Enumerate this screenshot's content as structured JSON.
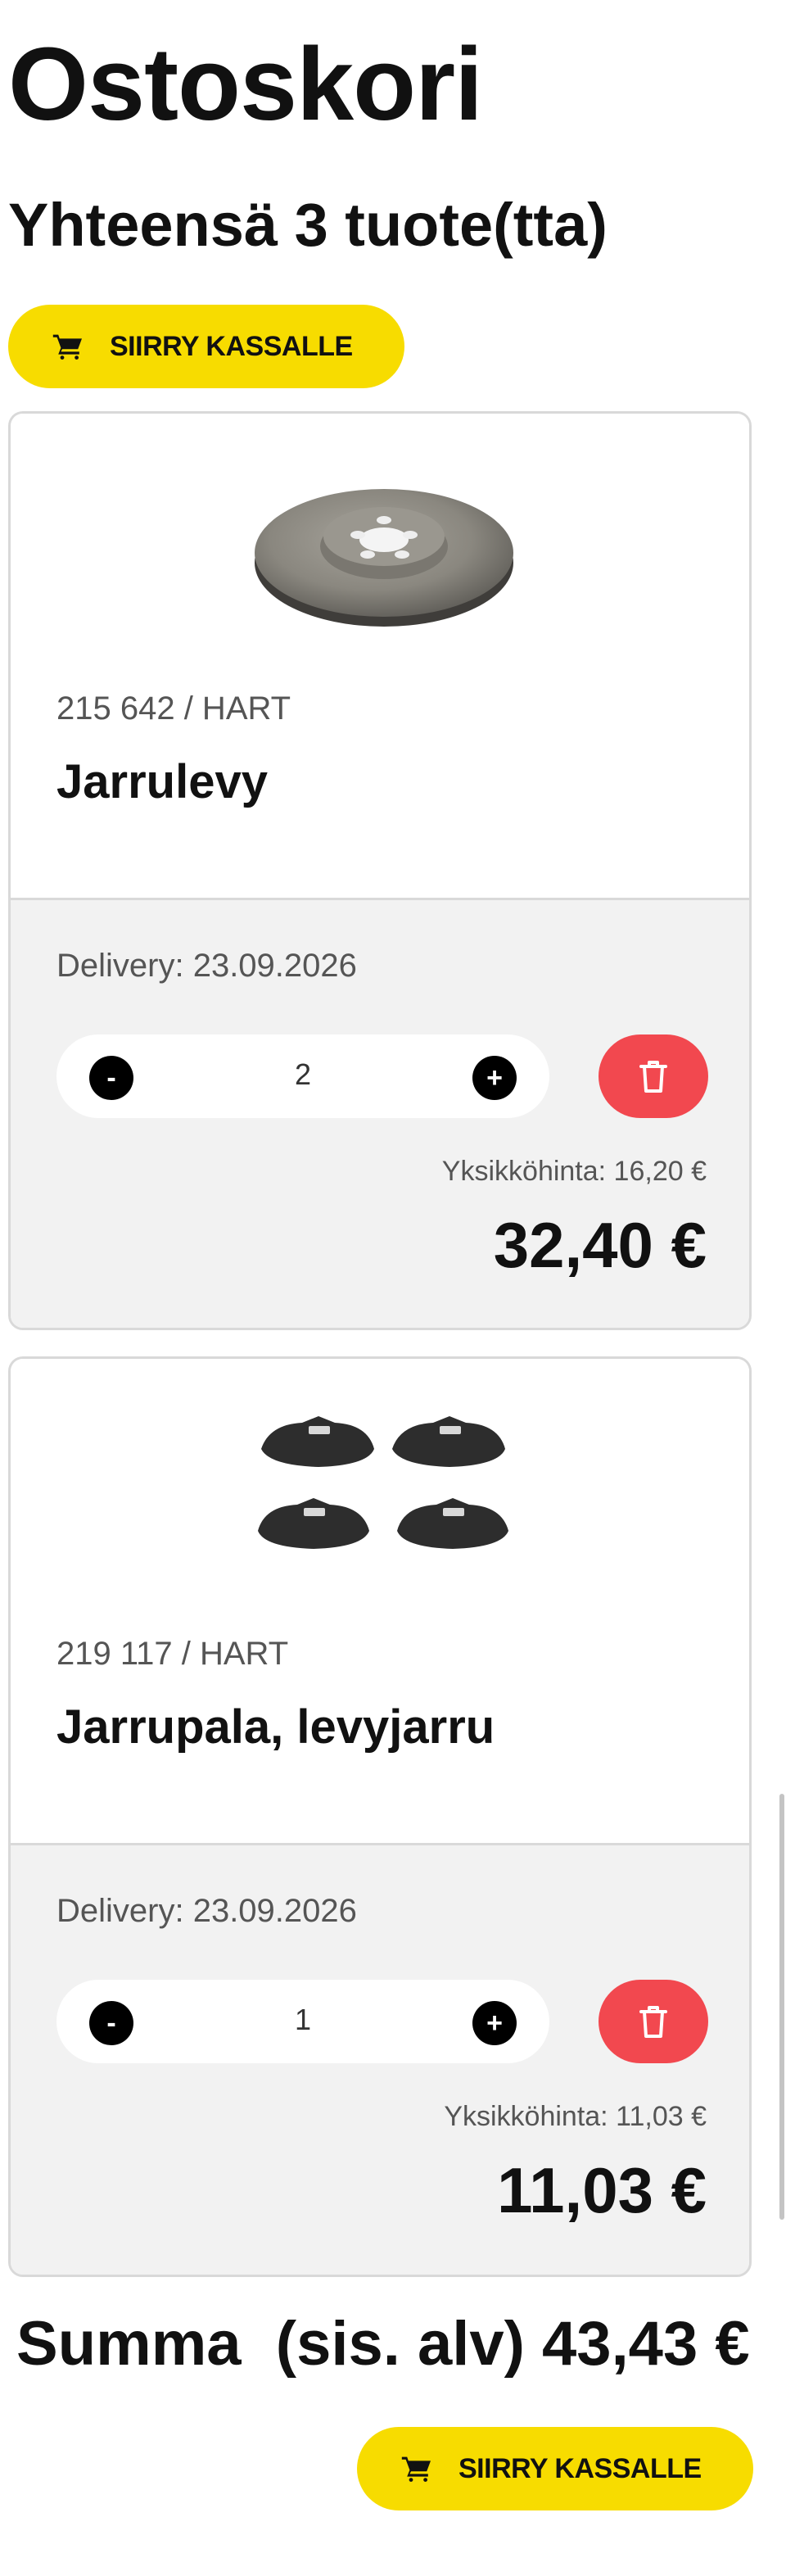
{
  "page": {
    "title": "Ostoskori",
    "subtitle": "Yhteensä 3 tuote(tta)"
  },
  "checkout": {
    "label": "SIIRRY KASSALLE",
    "icon": "cart-icon",
    "color": "#f7dc00"
  },
  "items": [
    {
      "sku": "215 642 / HART",
      "name": "Jarrulevy",
      "image": "brake-disc-image",
      "delivery": "Delivery: 23.09.2026",
      "qty": "2",
      "minus_label": "-",
      "plus_label": "+",
      "unit_price": "Yksikköhinta: 16,20 €",
      "total": "32,40 €"
    },
    {
      "sku": "219 117 / HART",
      "name": "Jarrupala, levyjarru",
      "image": "brake-pads-image",
      "delivery": "Delivery: 23.09.2026",
      "qty": "1",
      "minus_label": "-",
      "plus_label": "+",
      "unit_price": "Yksikköhinta: 11,03 €",
      "total": "11,03 €"
    }
  ],
  "summary": {
    "text": "Summa  (sis. alv) 43,43 €"
  },
  "colors": {
    "accent": "#f7dc00",
    "danger": "#f2484f",
    "panel": "#f2f2f2"
  }
}
